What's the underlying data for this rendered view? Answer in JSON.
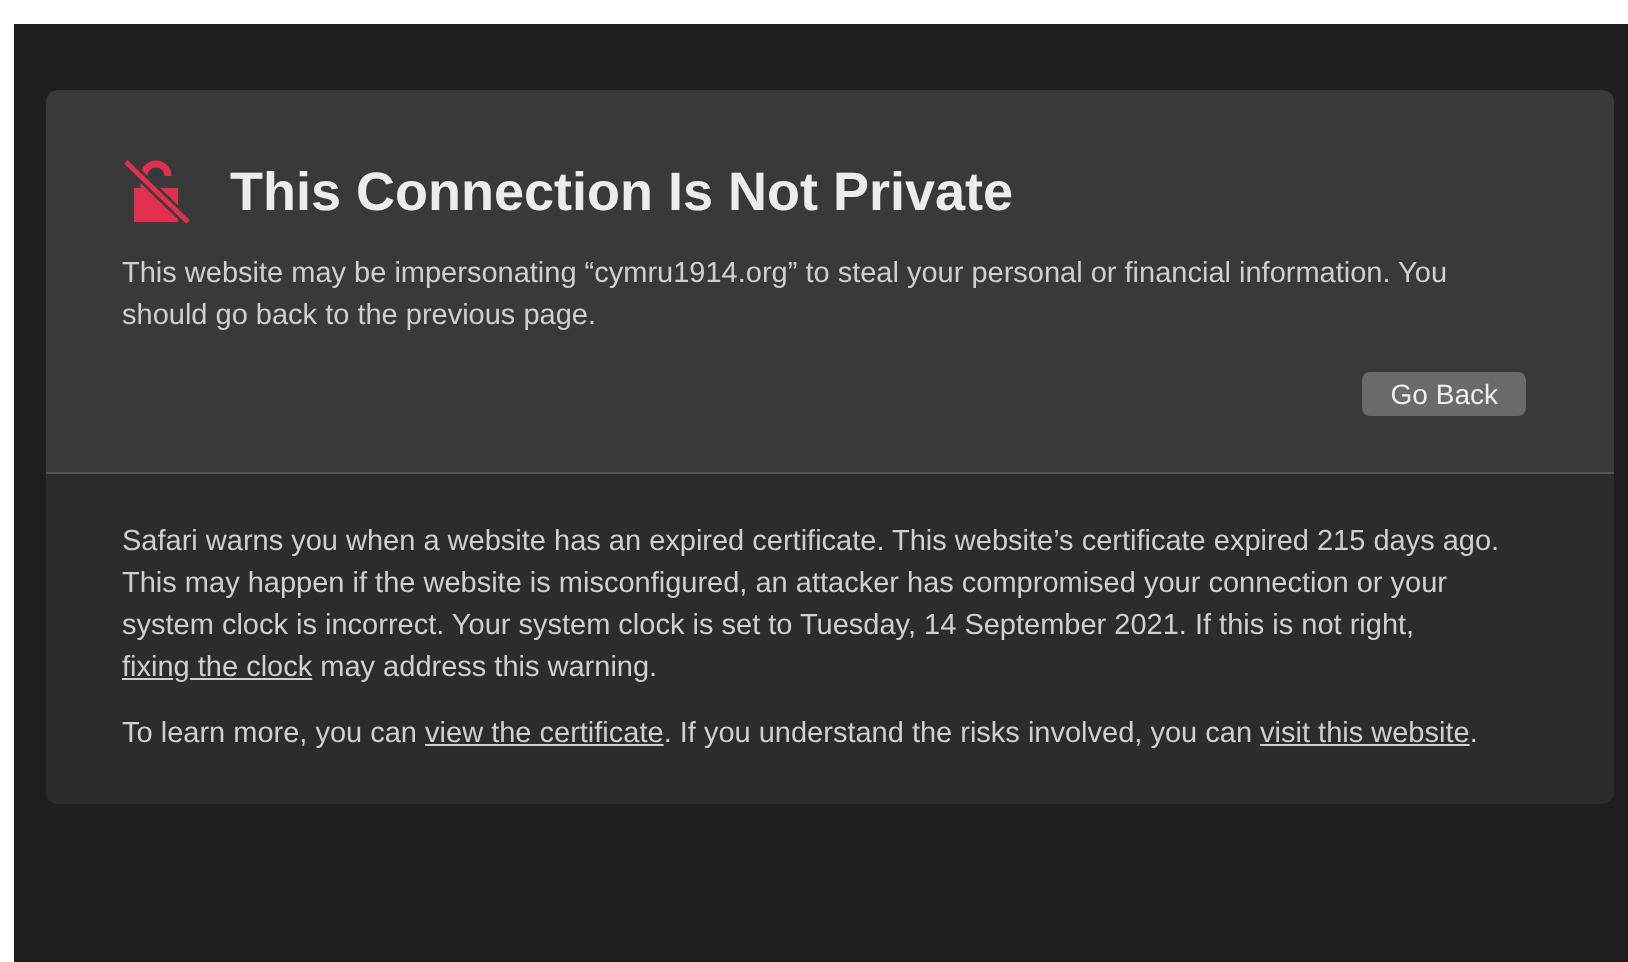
{
  "warning": {
    "title": "This Connection Is Not Private",
    "message": "This website may be impersonating “cymru1914.org” to steal your personal or financial information. You should go back to the previous page.",
    "button": "Go Back"
  },
  "details": [
    [
      {
        "kind": "text",
        "text": "Safari warns you when a website has an expired certificate. This website’s certificate expired 215 days ago. This may happen if the website is misconfigured, an attacker has compromised your connection or your system clock is incorrect. Your system clock is set to Tuesday, 14 September 2021. If this is not right, "
      },
      {
        "kind": "link",
        "text": "fixing the clock"
      },
      {
        "kind": "text",
        "text": " may address this warning."
      }
    ],
    [
      {
        "kind": "text",
        "text": "To learn more, you can "
      },
      {
        "kind": "link",
        "text": "view the certificate"
      },
      {
        "kind": "text",
        "text": ". If you understand the risks involved, you can "
      },
      {
        "kind": "link",
        "text": "visit this website"
      },
      {
        "kind": "text",
        "text": "."
      }
    ]
  ]
}
